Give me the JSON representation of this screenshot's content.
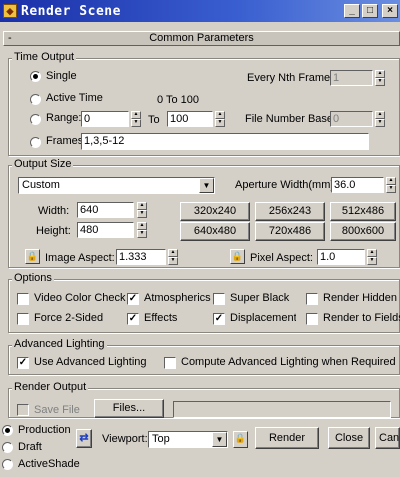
{
  "window": {
    "title": "Render Scene",
    "buttons": {
      "minimize": "_",
      "maximize": "□",
      "close": "×"
    }
  },
  "rollout": {
    "title": "Common Parameters",
    "toggle": "-"
  },
  "time_output": {
    "label": "Time Output",
    "single": "Single",
    "active_time": "Active Time",
    "active_range": "0 To 100",
    "range": "Range:",
    "range_from": "0",
    "to": "To",
    "range_to": "100",
    "frames": "Frames",
    "frames_value": "1,3,5-12",
    "every_nth_label": "Every Nth Frame:",
    "every_nth_value": "1",
    "file_number_base_label": "File Number Base:",
    "file_number_base_value": "0"
  },
  "output_size": {
    "label": "Output Size",
    "preset": "Custom",
    "aperture_label": "Aperture Width(mm):",
    "aperture_value": "36.0",
    "width_label": "Width:",
    "width_value": "640",
    "height_label": "Height:",
    "height_value": "480",
    "presets": [
      "320x240",
      "256x243",
      "512x486",
      "640x480",
      "720x486",
      "800x600"
    ],
    "image_aspect_label": "Image Aspect:",
    "image_aspect_value": "1.333",
    "pixel_aspect_label": "Pixel Aspect:",
    "pixel_aspect_value": "1.0"
  },
  "options": {
    "label": "Options",
    "items": [
      {
        "label": "Video Color Check",
        "checked": false
      },
      {
        "label": "Atmospherics",
        "checked": true
      },
      {
        "label": "Super Black",
        "checked": false
      },
      {
        "label": "Render Hidden",
        "checked": false
      },
      {
        "label": "Force 2-Sided",
        "checked": false
      },
      {
        "label": "Effects",
        "checked": true
      },
      {
        "label": "Displacement",
        "checked": true
      },
      {
        "label": "Render to Fields",
        "checked": false
      }
    ]
  },
  "advanced_lighting": {
    "label": "Advanced Lighting",
    "use": "Use Advanced Lighting",
    "compute": "Compute Advanced Lighting when Required"
  },
  "render_output": {
    "label": "Render Output",
    "save_file": "Save File",
    "files_button": "Files..."
  },
  "bottom": {
    "modes": [
      "Production",
      "Draft",
      "ActiveShade"
    ],
    "viewport_label": "Viewport:",
    "viewport_value": "Top",
    "render": "Render",
    "close": "Close",
    "cancel": "Cancel"
  }
}
